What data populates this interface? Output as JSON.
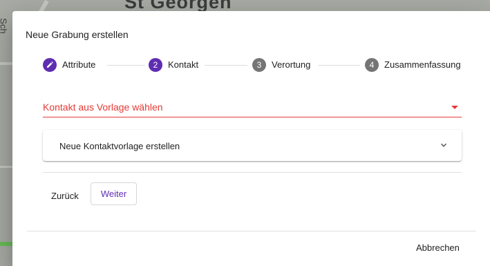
{
  "background": {
    "map_label": "St Georgen",
    "map_side_label": "Sch"
  },
  "dialog": {
    "title": "Neue Grabung erstellen",
    "steps": [
      {
        "number": "1",
        "label": "Attribute",
        "icon": "pencil-icon",
        "state": "done"
      },
      {
        "number": "2",
        "label": "Kontakt",
        "state": "active"
      },
      {
        "number": "3",
        "label": "Verortung",
        "state": "idle"
      },
      {
        "number": "4",
        "label": "Zusammenfassung",
        "state": "idle"
      }
    ],
    "contact_select": {
      "placeholder": "Kontakt aus Vorlage wählen",
      "icon": "dropdown-arrow-icon"
    },
    "expansion_panel": {
      "title": "Neue Kontaktvorlage erstellen",
      "icon": "chevron-down-icon"
    },
    "buttons": {
      "back": "Zurück",
      "next": "Weiter",
      "cancel": "Abbrechen"
    }
  },
  "colors": {
    "accent": "#5f2db2",
    "error": "#e53935",
    "inactive_step": "#757575"
  }
}
